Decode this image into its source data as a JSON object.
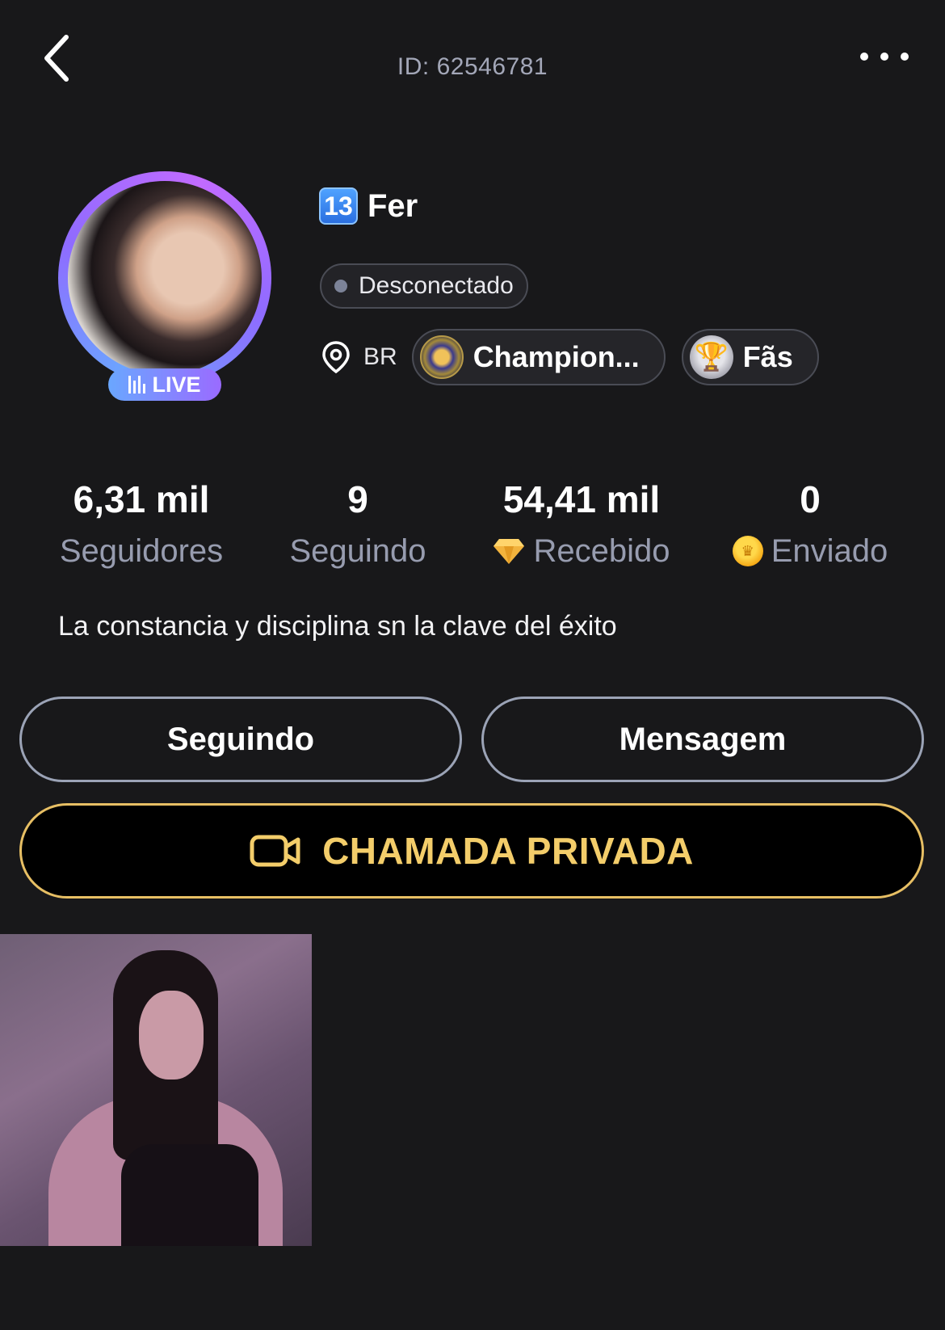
{
  "header": {
    "id_text": "ID: 62546781",
    "back_icon": "chevron-left-icon",
    "more_icon": "more-horizontal-icon"
  },
  "profile": {
    "level": "13",
    "name": "Fer",
    "live_label": "LIVE",
    "status": "Desconectado",
    "country": "BR",
    "badge_champion": "Champion...",
    "badge_fans": "Fãs"
  },
  "stats": [
    {
      "value": "6,31 mil",
      "label": "Seguidores"
    },
    {
      "value": "9",
      "label": "Seguindo"
    },
    {
      "value": "54,41 mil",
      "label": "Recebido",
      "icon": "gem-icon"
    },
    {
      "value": "0",
      "label": "Enviado",
      "icon": "coin-icon"
    }
  ],
  "bio": "La constancia y disciplina sn la clave del éxito",
  "actions": {
    "following_label": "Seguindo",
    "message_label": "Mensagem",
    "private_call_label": "CHAMADA PRIVADA"
  },
  "colors": {
    "background": "#18181a",
    "gold": "#f3cd6a",
    "muted": "#979caf",
    "live_gradient_start": "#6aa7ff",
    "live_gradient_end": "#9a6bff"
  }
}
